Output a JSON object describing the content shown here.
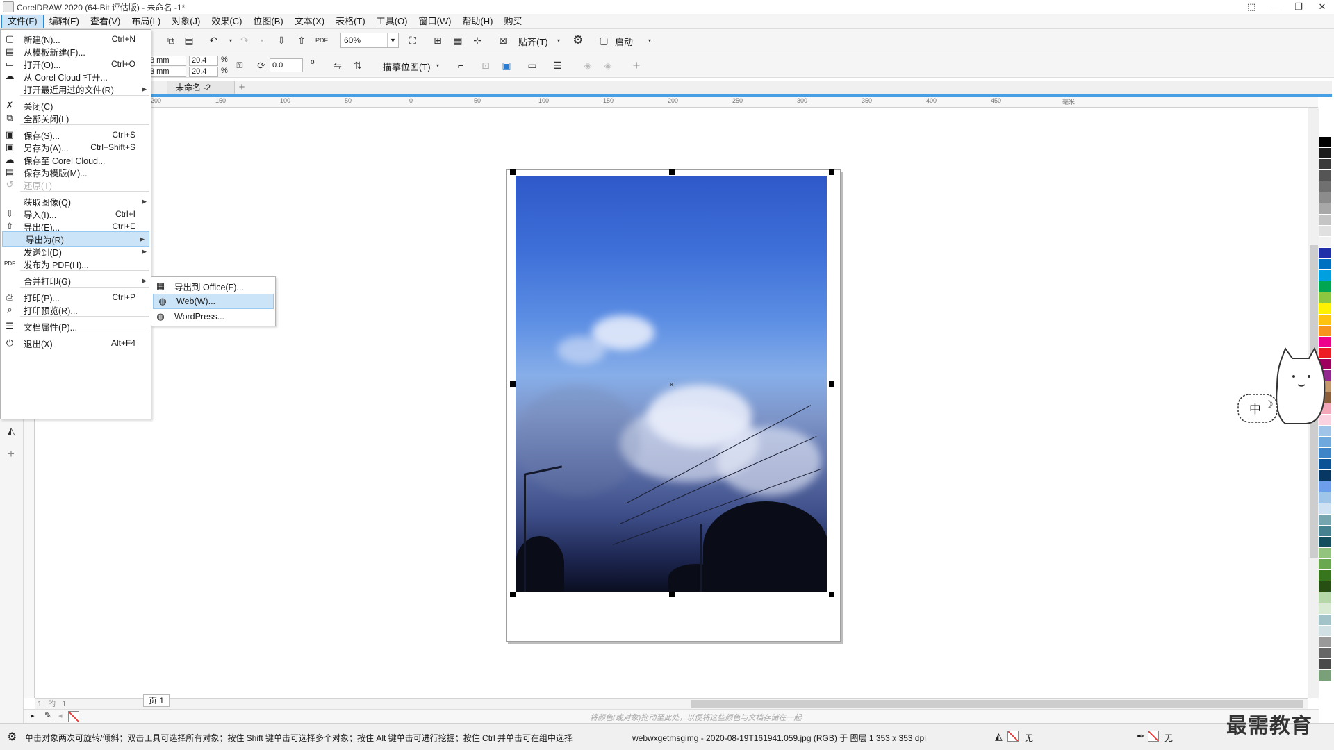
{
  "window": {
    "title": "CorelDRAW 2020 (64-Bit 评估版) - 未命名 -1*",
    "controls": [
      "⬚",
      "—",
      "❐",
      "✕"
    ]
  },
  "menubar": [
    "文件(F)",
    "编辑(E)",
    "查看(V)",
    "布局(L)",
    "对象(J)",
    "效果(C)",
    "位图(B)",
    "文本(X)",
    "表格(T)",
    "工具(O)",
    "窗口(W)",
    "帮助(H)",
    "购买"
  ],
  "toolbar": {
    "zoom": "60%",
    "snap_label": "贴齐(T)",
    "launch_label": "启动"
  },
  "propertybar": {
    "w_mm": "3 mm",
    "h_mm": "3 mm",
    "scale_x": "20.4",
    "scale_y": "20.4",
    "pct": "%",
    "rotation": "0.0",
    "degree": "o",
    "trace_label": "描摹位图(T)"
  },
  "doc_tab": "未命名 -2",
  "ruler_marks": [
    "200",
    "150",
    "100",
    "50",
    "0",
    "50",
    "100",
    "150",
    "200",
    "250",
    "300",
    "350",
    "400",
    "450"
  ],
  "ruler_unit": "毫米",
  "page_tab": "页 1",
  "page_nav": "1 的 1",
  "colorbar_hint": "将颜色(或对象)拖动至此处，以便将这些颜色与文档存储在一起",
  "status": {
    "hint": "单击对象两次可旋转/倾斜；双击工具可选择所有对象；按住 Shift 键单击可选择多个对象；按住 Alt 键单击可进行挖掘；按住 Ctrl 并单击可在组中选择",
    "file_info": "webwxgetmsgimg - 2020-08-19T161941.059.jpg (RGB) 于 图层 1 353 x 353 dpi",
    "fill": "无",
    "outline": "无"
  },
  "watermark": "最需教育",
  "mascot_text": "中",
  "file_menu": [
    {
      "label": "新建(N)...",
      "shortcut": "Ctrl+N",
      "icon": "new-doc-icon",
      "glyph": "▢"
    },
    {
      "label": "从模板新建(F)...",
      "shortcut": "",
      "icon": "template-icon",
      "glyph": "▤"
    },
    {
      "label": "打开(O)...",
      "shortcut": "Ctrl+O",
      "icon": "folder-open-icon",
      "glyph": "▭"
    },
    {
      "label": "从 Corel Cloud 打开...",
      "shortcut": "",
      "icon": "cloud-open-icon",
      "glyph": "☁"
    },
    {
      "label": "打开最近用过的文件(R)",
      "shortcut": "",
      "icon": "",
      "glyph": "",
      "submenu": true
    },
    {
      "label": "关闭(C)",
      "shortcut": "",
      "icon": "close-doc-icon",
      "glyph": "✗"
    },
    {
      "label": "全部关闭(L)",
      "shortcut": "",
      "icon": "close-all-icon",
      "glyph": "⧉"
    },
    {
      "label": "保存(S)...",
      "shortcut": "Ctrl+S",
      "icon": "save-icon",
      "glyph": "▣"
    },
    {
      "label": "另存为(A)...",
      "shortcut": "Ctrl+Shift+S",
      "icon": "save-as-icon",
      "glyph": "▣"
    },
    {
      "label": "保存至 Corel Cloud...",
      "shortcut": "",
      "icon": "cloud-save-icon",
      "glyph": "☁"
    },
    {
      "label": "保存为模版(M)...",
      "shortcut": "",
      "icon": "save-template-icon",
      "glyph": "▤"
    },
    {
      "label": "还原(T)",
      "shortcut": "",
      "icon": "revert-icon",
      "glyph": "↺",
      "disabled": true
    },
    {
      "label": "获取图像(Q)",
      "shortcut": "",
      "icon": "",
      "glyph": "",
      "submenu": true
    },
    {
      "label": "导入(I)...",
      "shortcut": "Ctrl+I",
      "icon": "import-icon",
      "glyph": "⇩"
    },
    {
      "label": "导出(E)...",
      "shortcut": "Ctrl+E",
      "icon": "export-icon",
      "glyph": "⇧"
    },
    {
      "label": "导出为(R)",
      "shortcut": "",
      "icon": "",
      "glyph": "",
      "submenu": true,
      "hover": true
    },
    {
      "label": "发送到(D)",
      "shortcut": "",
      "icon": "",
      "glyph": "",
      "submenu": true
    },
    {
      "label": "发布为 PDF(H)...",
      "shortcut": "",
      "icon": "pdf-icon",
      "glyph": "PDF"
    },
    {
      "label": "合并打印(G)",
      "shortcut": "",
      "icon": "",
      "glyph": "",
      "submenu": true
    },
    {
      "label": "打印(P)...",
      "shortcut": "Ctrl+P",
      "icon": "print-icon",
      "glyph": "⎙"
    },
    {
      "label": "打印预览(R)...",
      "shortcut": "",
      "icon": "print-preview-icon",
      "glyph": "⌕"
    },
    {
      "label": "文档属性(P)...",
      "shortcut": "",
      "icon": "doc-properties-icon",
      "glyph": "☰"
    },
    {
      "label": "退出(X)",
      "shortcut": "Alt+F4",
      "icon": "exit-icon",
      "glyph": "⏻"
    }
  ],
  "export_submenu": [
    {
      "label": "导出到 Office(F)...",
      "icon": "office-export-icon",
      "glyph": "▦"
    },
    {
      "label": "Web(W)...",
      "icon": "web-export-icon",
      "glyph": "◍",
      "hover": true
    },
    {
      "label": "WordPress...",
      "icon": "wordpress-icon",
      "glyph": "◍"
    }
  ],
  "palette_colors": [
    "#ffffff",
    "#000000",
    "#1c1c1c",
    "#3a3a3a",
    "#555555",
    "#707070",
    "#8c8c8c",
    "#a8a8a8",
    "#c4c4c4",
    "#e0e0e0",
    "#f2f2f2",
    "#1f2fa8",
    "#0070c0",
    "#00a0e0",
    "#00a651",
    "#8dc63f",
    "#fff200",
    "#ffc20e",
    "#f7941d",
    "#ec008c",
    "#ed1c24",
    "#9e005d",
    "#92278f",
    "#c49a6c",
    "#8b5e3c",
    "#f4a7b9",
    "#fbd3e0",
    "#a0c4e8",
    "#6fa8dc",
    "#3d85c6",
    "#0b5394",
    "#073763",
    "#6d9eeb",
    "#9fc5e8",
    "#cfe2f3",
    "#76a5af",
    "#45818e",
    "#134f5c",
    "#93c47d",
    "#6aa84f",
    "#38761d",
    "#274e13",
    "#b6d7a8",
    "#d9ead3",
    "#a2c4c9",
    "#d0e0e3",
    "#999999",
    "#666666",
    "#4a4a4a",
    "#7aa07a"
  ]
}
